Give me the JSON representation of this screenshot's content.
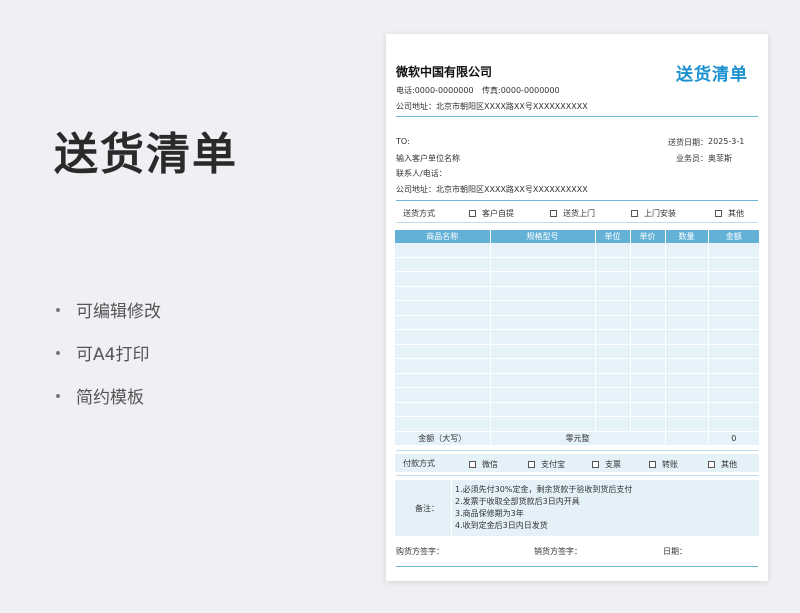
{
  "hero": {
    "title": "送货清单",
    "features": [
      "可编辑修改",
      "可A4打印",
      "简约模板"
    ]
  },
  "sheet": {
    "company": "微软中国有限公司",
    "doc_title": "送货清单",
    "phone": "电话:0000-0000000",
    "fax": "传真:0000-0000000",
    "address": "公司地址：北京市朝阳区XXXX路XX号XXXXXXXXXX",
    "to_label": "TO:",
    "customer_name": "输入客户单位名称",
    "contact": "联系人/电话：",
    "customer_address": "公司地址：北京市朝阳区XXXX路XX号XXXXXXXXXX",
    "date_label": "送货日期：",
    "date_value": "2025-3-1",
    "salesperson_label": "业务员：",
    "salesperson_value": "奥菲斯",
    "delivery": {
      "label": "送货方式",
      "options": [
        "客户自提",
        "送货上门",
        "上门安装",
        "其他"
      ]
    },
    "table": {
      "headers": [
        "商品名称",
        "规格型号",
        "单位",
        "单价",
        "数量",
        "金额"
      ],
      "empty_rows": 13,
      "total_label": "金额（大写）",
      "total_words": "零元整",
      "total_value": "0"
    },
    "payment": {
      "label": "付款方式",
      "options": [
        "微信",
        "支付宝",
        "支票",
        "转账",
        "其他"
      ]
    },
    "notes": {
      "label": "备注：",
      "lines": [
        "1.必须先付30%定金，剩余货款于验收到货后支付",
        "2.发票于收取全部货款后3日内开具",
        "3.商品保修期为3年",
        "4.收到定金后3日内日发货"
      ]
    },
    "signatures": {
      "buyer": "购货方签字：",
      "seller": "销货方签字：",
      "date": "日期："
    }
  },
  "colors": {
    "accent": "#1a90d0",
    "header_fill": "#64b1d8",
    "cell_fill": "#e5f2fa"
  }
}
